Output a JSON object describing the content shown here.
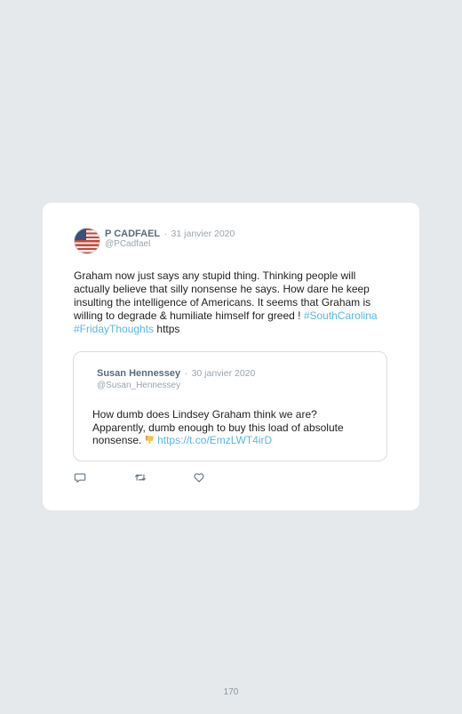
{
  "tweet": {
    "author_name": "P CADFAEL",
    "separator": "·",
    "date": "31 janvier 2020",
    "handle": "@PCadfael",
    "text_main": "Graham now just says any stupid thing. Thinking people will actually believe that silly nonsense he says. How dare he keep insulting the intelligence of Americans. It seems that Graham is willing to degrade & humiliate himself for greed !",
    "hashtags": [
      "#SouthCarolina",
      "#FridayThoughts"
    ],
    "text_tail": "https"
  },
  "quoted_tweet": {
    "author_name": "Susan Hennessey",
    "separator": "·",
    "date": "30 janvier 2020",
    "handle": "@Susan_Hennessey",
    "text": "How dumb does Lindsey Graham think we are? Apparently, dumb enough to buy this load of absolute nonsense.",
    "emoji_icon": "thumbs-down-emoji",
    "link": "https://t.co/EmzLWT4irD"
  },
  "actions": {
    "reply_icon": "reply-icon",
    "retweet_icon": "retweet-icon",
    "like_icon": "heart-icon"
  },
  "page": {
    "number": "170"
  },
  "colors": {
    "background": "#e5e9ec",
    "card": "#ffffff",
    "link": "#5ab6e8",
    "muted": "#9aa4ad"
  }
}
